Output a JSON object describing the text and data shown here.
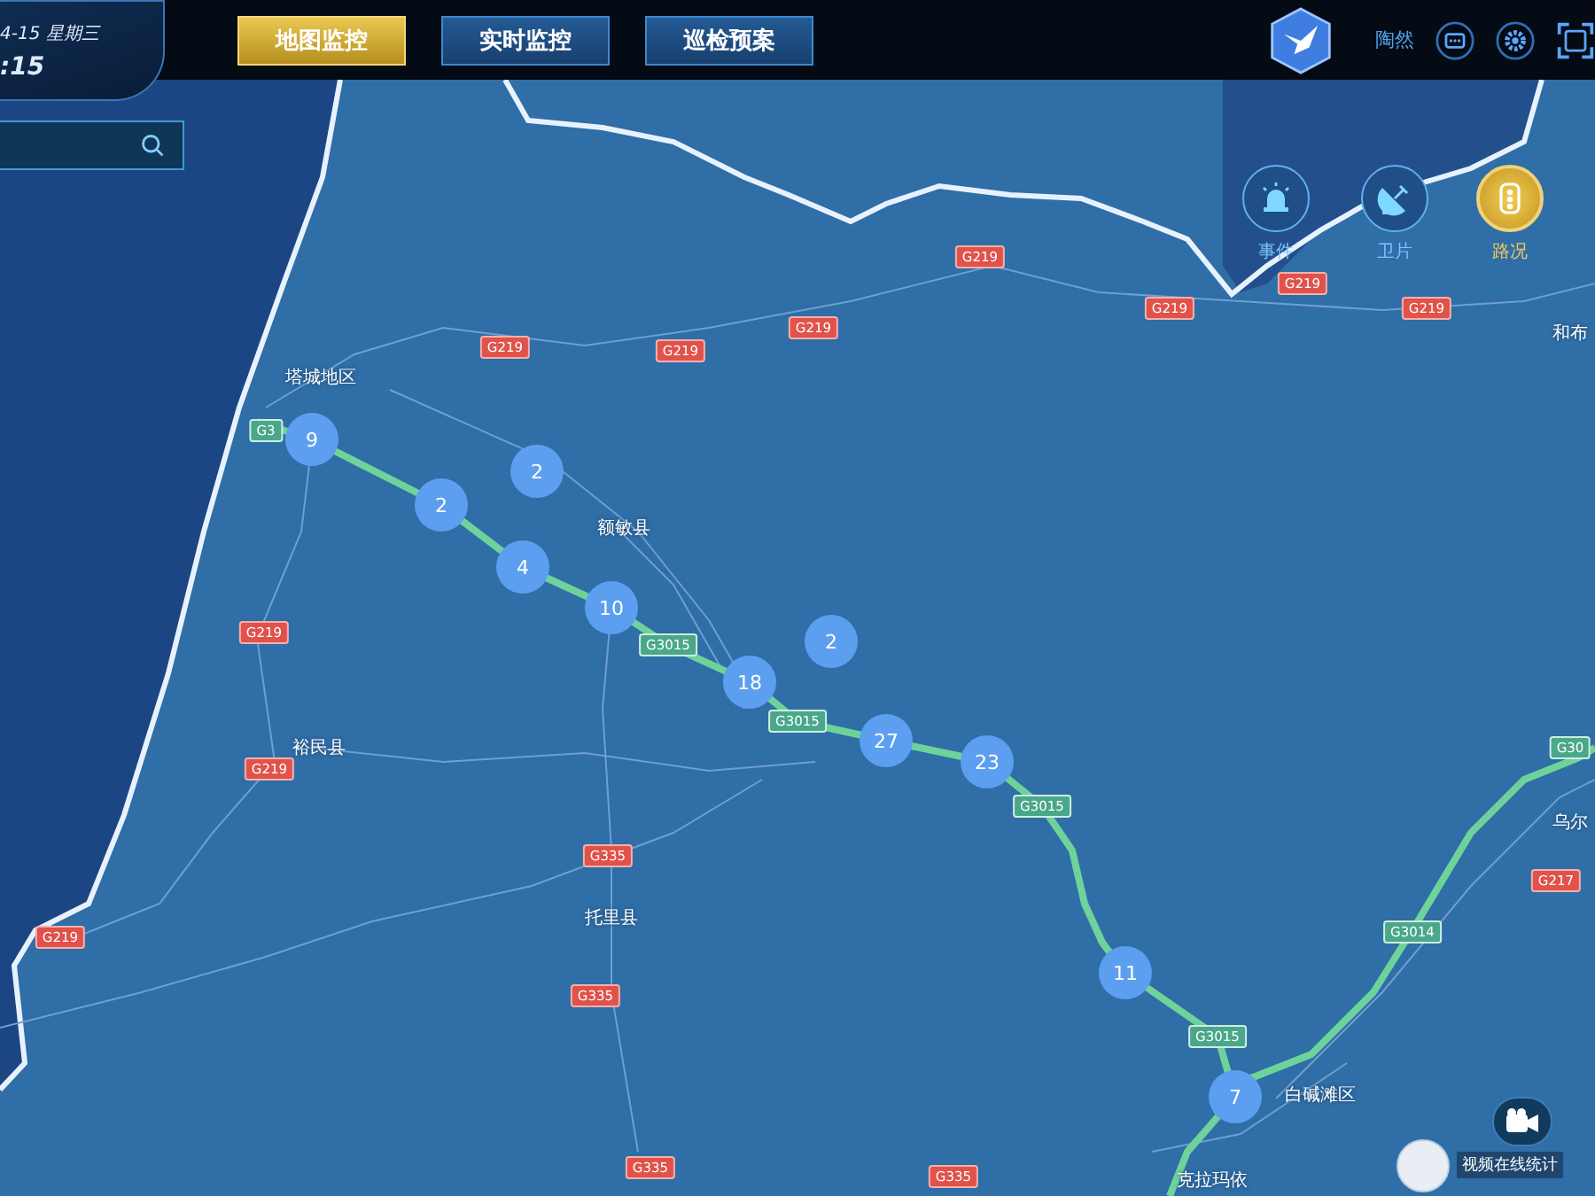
{
  "header": {
    "date": "4-15 星期三",
    "time": ":15",
    "user": "陶然",
    "tabs": [
      {
        "label": "地图监控",
        "selected": true
      },
      {
        "label": "实时监控",
        "selected": false
      },
      {
        "label": "巡检预案",
        "selected": false
      }
    ]
  },
  "layers": [
    {
      "label": "事件",
      "kind": "alarm",
      "selected": false
    },
    {
      "label": "卫片",
      "kind": "satellite",
      "selected": false
    },
    {
      "label": "路况",
      "kind": "traffic",
      "selected": true
    }
  ],
  "map": {
    "places": [
      "塔城地区",
      "额敏县",
      "裕民县",
      "托里县",
      "白碱滩区",
      "克拉玛依",
      "和布",
      "乌尔"
    ],
    "road_shields": [
      {
        "label": "G219",
        "kind": "national"
      },
      {
        "label": "G219",
        "kind": "national"
      },
      {
        "label": "G219",
        "kind": "national"
      },
      {
        "label": "G219",
        "kind": "national"
      },
      {
        "label": "G219",
        "kind": "national"
      },
      {
        "label": "G219",
        "kind": "national"
      },
      {
        "label": "G219",
        "kind": "national"
      },
      {
        "label": "G219",
        "kind": "national"
      },
      {
        "label": "G219",
        "kind": "national"
      },
      {
        "label": "G219",
        "kind": "national"
      },
      {
        "label": "G335",
        "kind": "national"
      },
      {
        "label": "G335",
        "kind": "national"
      },
      {
        "label": "G335",
        "kind": "national"
      },
      {
        "label": "G335",
        "kind": "national"
      },
      {
        "label": "G217",
        "kind": "national"
      },
      {
        "label": "G3015",
        "kind": "expressway"
      },
      {
        "label": "G3015",
        "kind": "expressway"
      },
      {
        "label": "G3015",
        "kind": "expressway"
      },
      {
        "label": "G3015",
        "kind": "expressway"
      },
      {
        "label": "G3014",
        "kind": "expressway"
      },
      {
        "label": "G3",
        "kind": "expressway"
      },
      {
        "label": "G30",
        "kind": "expressway"
      }
    ],
    "clusters": [
      "9",
      "2",
      "2",
      "4",
      "10",
      "2",
      "18",
      "27",
      "23",
      "11",
      "7"
    ]
  },
  "video_stats": {
    "label": "视频在线统计"
  }
}
